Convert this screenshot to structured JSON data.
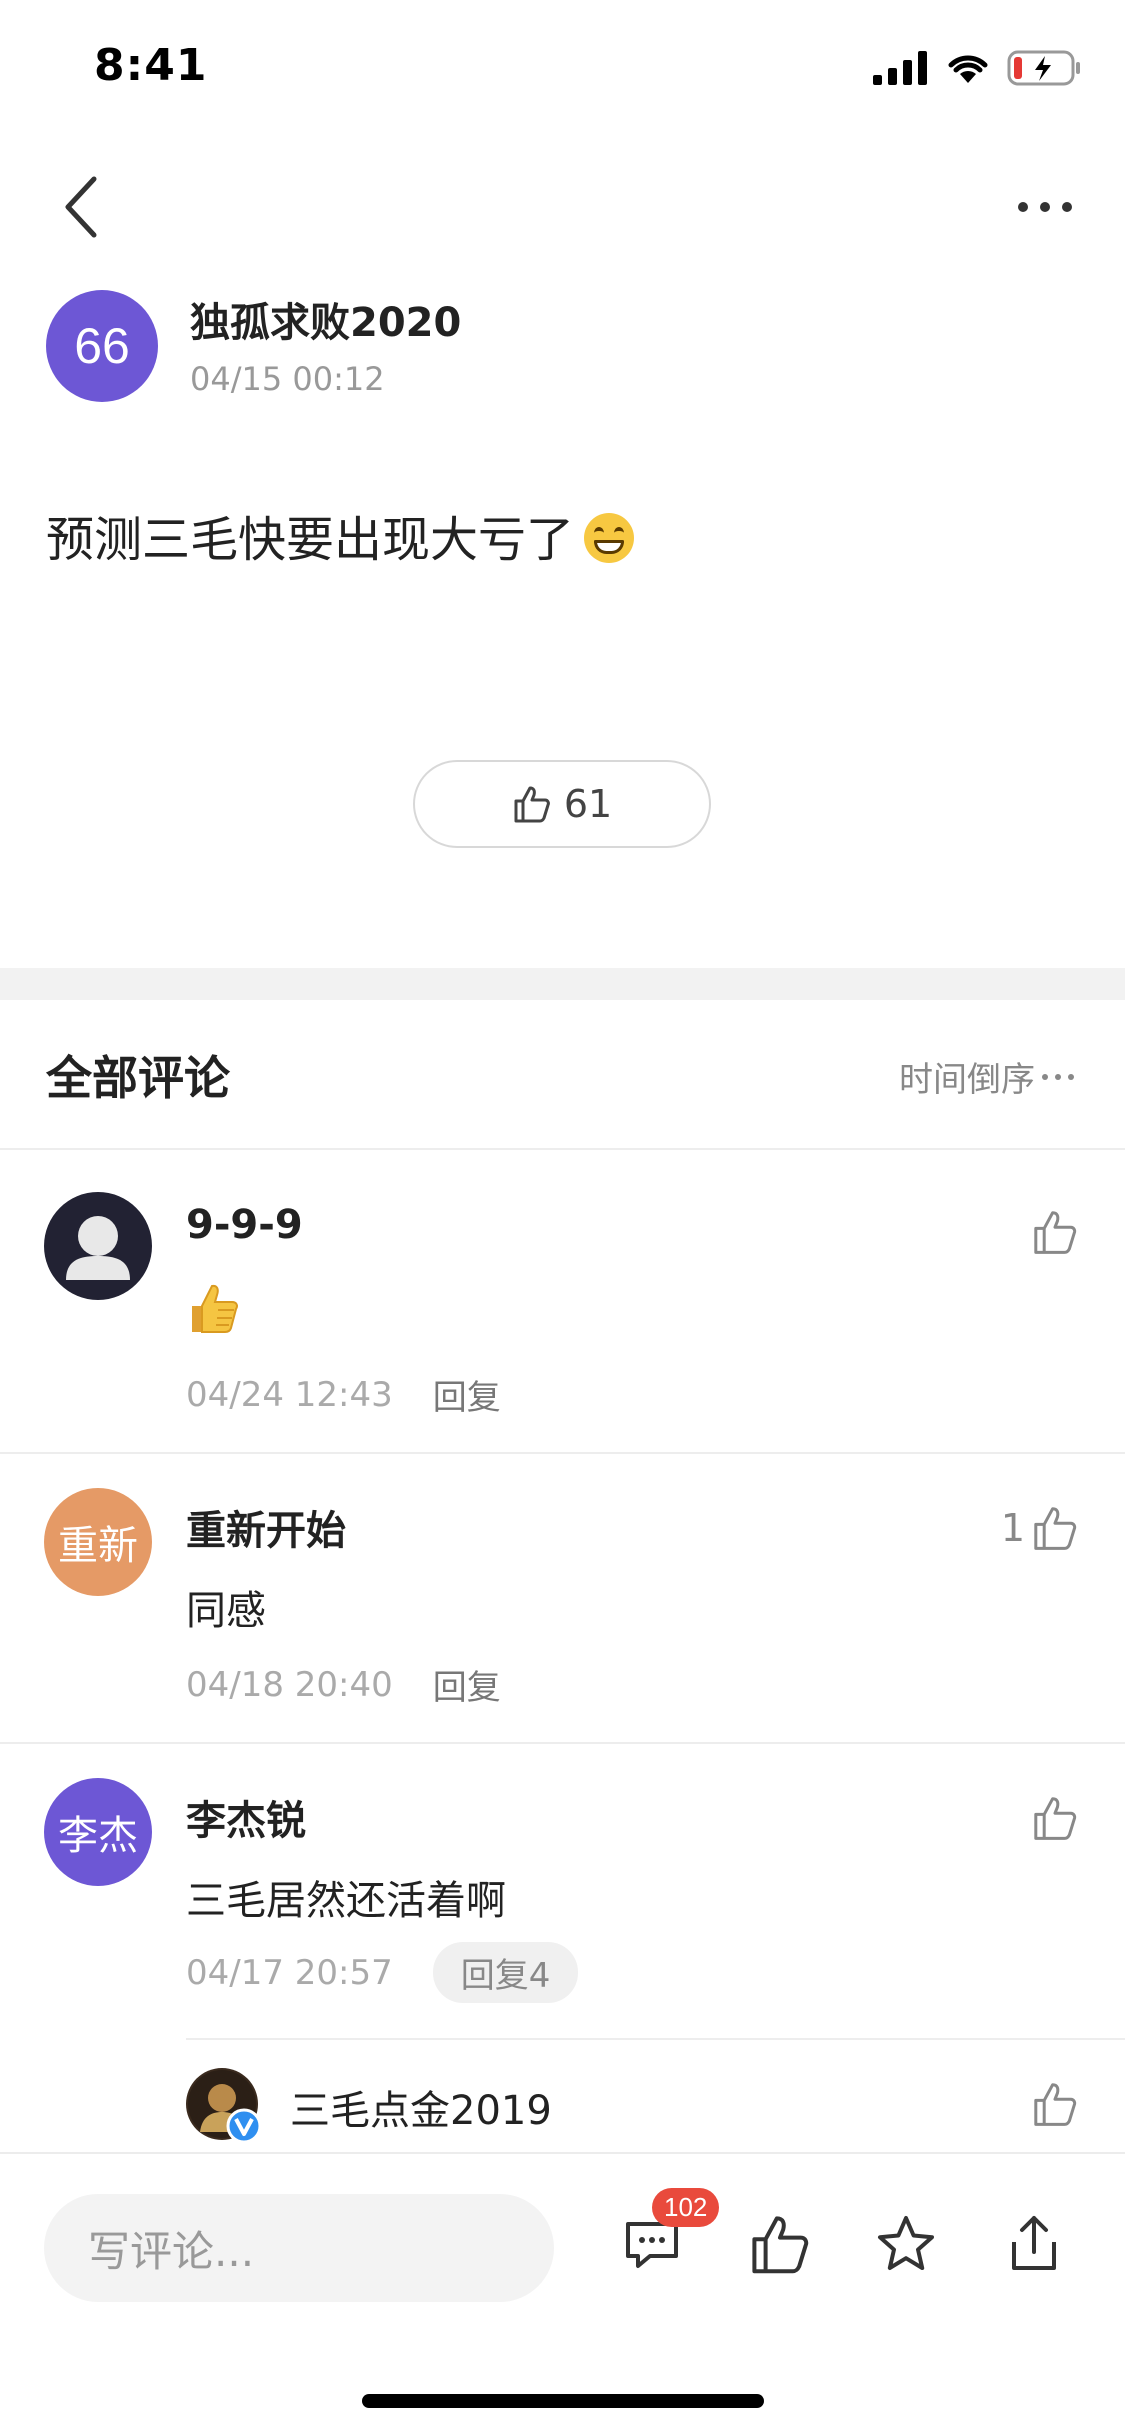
{
  "status_bar": {
    "time": "8:41"
  },
  "post": {
    "author_avatar_text": "66",
    "author_name": "独孤求败2020",
    "timestamp": "04/15 00:12",
    "body": "预测三毛快要出现大亏了",
    "like_count": "61"
  },
  "comments_section": {
    "title": "全部评论",
    "sort_label": "时间倒序",
    "comments": [
      {
        "name": "9-9-9",
        "text": "",
        "time": "04/24 12:43",
        "reply_label": "回复",
        "likes": ""
      },
      {
        "avatar_text": "重新",
        "name": "重新开始",
        "text": "同感",
        "time": "04/18 20:40",
        "reply_label": "回复",
        "likes": "1"
      },
      {
        "avatar_text": "李杰",
        "name": "李杰锐",
        "text": "三毛居然还活着啊",
        "time": "04/17 20:57",
        "reply_label": "回复4",
        "likes": ""
      }
    ],
    "sub_reply": {
      "name": "三毛点金2019"
    }
  },
  "bottom_bar": {
    "input_placeholder": "写评论...",
    "comment_badge": "102"
  },
  "colors": {
    "avatar_66": "#6d57d5",
    "avatar_chongxin": "#e59a66",
    "avatar_lijie": "#6d57d5",
    "badge": "#e94a3c"
  }
}
